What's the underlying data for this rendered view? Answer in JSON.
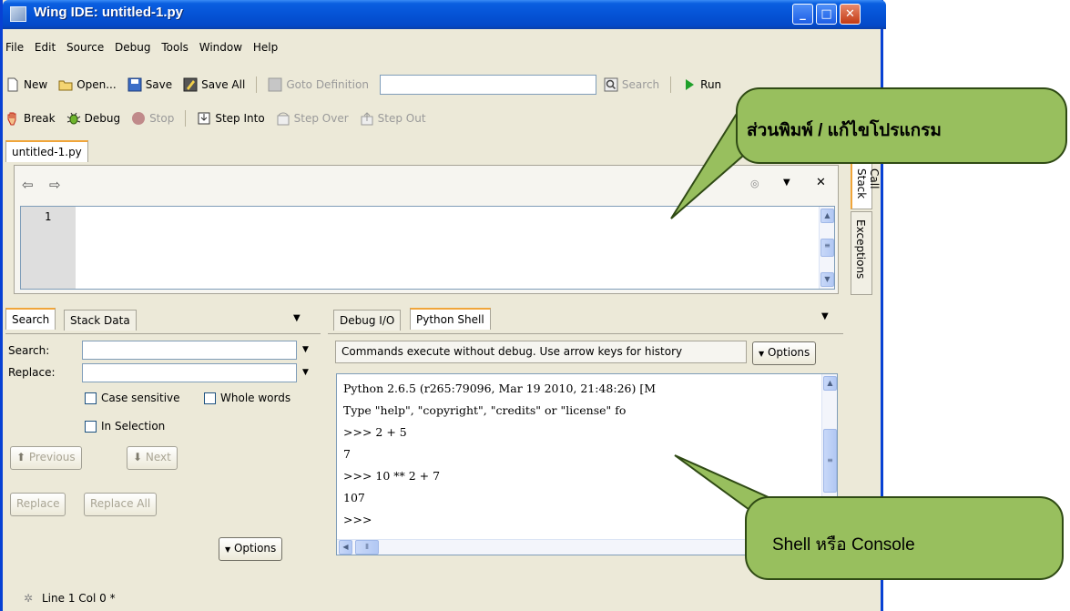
{
  "window": {
    "title": "Wing IDE: untitled-1.py"
  },
  "caption_buttons": {
    "minimize": "_",
    "maximize": "□",
    "close": "✕"
  },
  "menu": [
    "File",
    "Edit",
    "Source",
    "Debug",
    "Tools",
    "Window",
    "Help"
  ],
  "toolbar1": {
    "new": "New",
    "open": "Open...",
    "save": "Save",
    "save_all": "Save All",
    "goto_definition": "Goto Definition",
    "goto_value": "",
    "search": "Search",
    "run": "Run"
  },
  "toolbar2": {
    "break": "Break",
    "debug": "Debug",
    "stop": "Stop",
    "step_into": "Step Into",
    "step_over": "Step Over",
    "step_out": "Step Out"
  },
  "editor": {
    "tab": "untitled-1.py",
    "line_number": "1"
  },
  "right_tabs": {
    "call_stack": "Call Stack",
    "exceptions": "Exceptions"
  },
  "search_panel": {
    "tabs": [
      "Search",
      "Stack Data"
    ],
    "search_label": "Search:",
    "replace_label": "Replace:",
    "search_value": "",
    "replace_value": "",
    "case_sensitive": "Case sensitive",
    "whole_words": "Whole words",
    "in_selection": "In Selection",
    "previous": "Previous",
    "next": "Next",
    "replace": "Replace",
    "replace_all": "Replace All",
    "options": "Options"
  },
  "shell_panel": {
    "tabs": [
      "Debug I/O",
      "Python Shell"
    ],
    "info": "Commands execute without debug.  Use arrow keys for history",
    "options": "Options",
    "lines": [
      "Python 2.6.5 (r265:79096, Mar 19 2010, 21:48:26) [M",
      "Type \"help\", \"copyright\", \"credits\" or \"license\" fo",
      ">>> 2 + 5",
      "7",
      ">>> 10 ** 2 + 7",
      "107",
      ">>>"
    ]
  },
  "statusbar": {
    "position": "Line 1 Col 0 *"
  },
  "callouts": {
    "editor": "ส่วนพิมพ์ / แก้ไขโปรแกรม",
    "shell": "Shell หรือ Console"
  },
  "colors": {
    "titlebar": "#0553d6",
    "callout_fill": "#98bf5e",
    "tab_accent": "#f0a53a"
  }
}
